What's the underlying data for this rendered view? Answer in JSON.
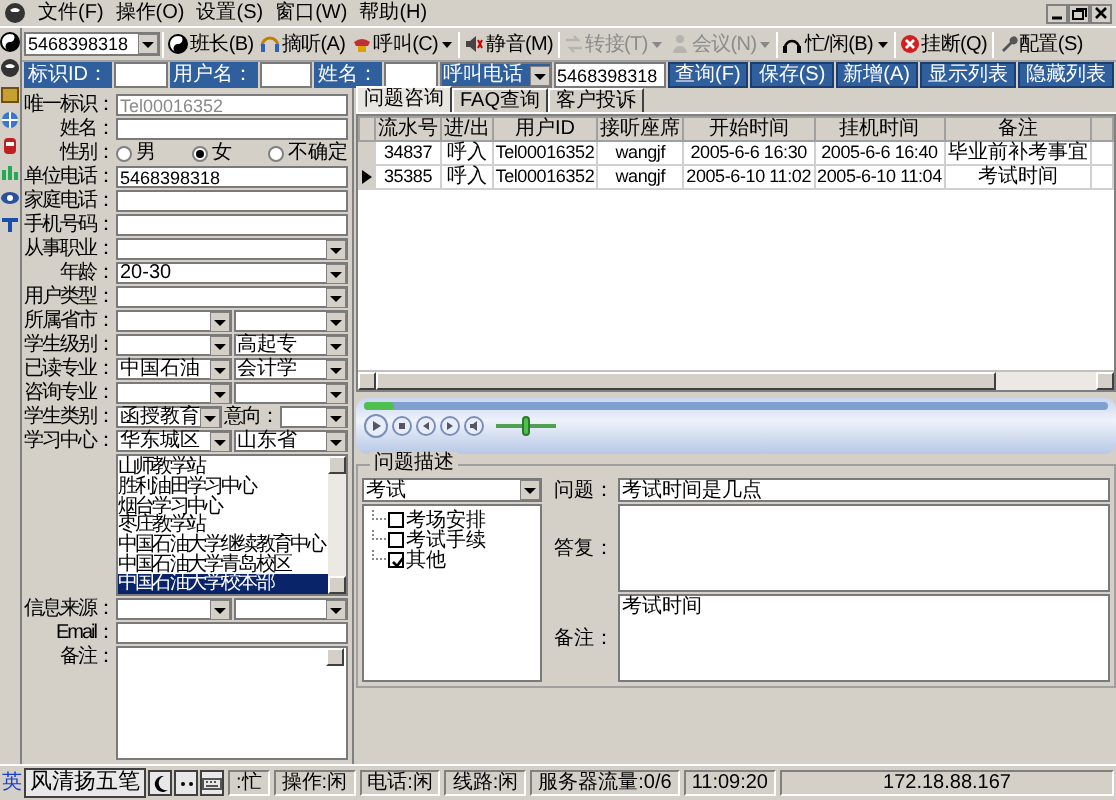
{
  "menu": [
    "文件(F)",
    "操作(O)",
    "设置(S)",
    "窗口(W)",
    "帮助(H)"
  ],
  "toolbar": {
    "phone": "5468398318",
    "buttons": [
      {
        "label": "班长(B)",
        "dropdown": false,
        "disabled": false
      },
      {
        "label": "摘听(A)",
        "dropdown": false,
        "disabled": false
      },
      {
        "label": "呼叫(C)",
        "dropdown": true,
        "disabled": false
      },
      {
        "label": "静音(M)",
        "dropdown": false,
        "disabled": false
      },
      {
        "label": "转接(T)",
        "dropdown": true,
        "disabled": true
      },
      {
        "label": "会议(N)",
        "dropdown": true,
        "disabled": true
      },
      {
        "label": "忙/闲(B)",
        "dropdown": true,
        "disabled": false
      },
      {
        "label": "挂断(Q)",
        "dropdown": false,
        "disabled": false
      },
      {
        "label": "配置(S)",
        "dropdown": false,
        "disabled": false
      }
    ]
  },
  "search": {
    "fields": [
      {
        "label": "标识ID："
      },
      {
        "label": "用户名："
      },
      {
        "label": "姓名："
      }
    ],
    "phone_type": "呼叫电话",
    "phone_value": "5468398318",
    "buttons": [
      "查询(F)",
      "保存(S)",
      "新增(A)",
      "显示列表",
      "隐藏列表"
    ]
  },
  "form": [
    {
      "kind": "text",
      "label": "唯一标识：",
      "value": "Tel00016352",
      "disabled": true
    },
    {
      "kind": "text",
      "label": "姓名："
    },
    {
      "kind": "radio",
      "label": "性别：",
      "options": [
        {
          "label": "男",
          "selected": false
        },
        {
          "label": "女",
          "selected": true
        },
        {
          "label": "不确定",
          "selected": false
        }
      ]
    },
    {
      "kind": "text",
      "label": "单位电话：",
      "value": "5468398318"
    },
    {
      "kind": "text",
      "label": "家庭电话："
    },
    {
      "kind": "text",
      "label": "手机号码："
    },
    {
      "kind": "select",
      "label": "从事职业：",
      "selects": [
        {
          "kind": "blank"
        }
      ]
    },
    {
      "kind": "select",
      "label": "年龄：",
      "selects": [
        {
          "kind": "filled",
          "value": "20-30"
        }
      ]
    },
    {
      "kind": "select",
      "label": "用户类型：",
      "selects": [
        {
          "kind": "blank"
        }
      ]
    },
    {
      "kind": "select",
      "label": "所属省市：",
      "selects": [
        {
          "kind": "blank"
        },
        {
          "kind": "blank"
        }
      ]
    },
    {
      "kind": "select",
      "label": "学生级别：",
      "selects": [
        {
          "kind": "blank"
        },
        {
          "kind": "filled",
          "value": "高起专"
        }
      ]
    },
    {
      "kind": "select",
      "label": "已读专业：",
      "selects": [
        {
          "kind": "filled",
          "value": "中国石油"
        },
        {
          "kind": "filled",
          "value": "会计学"
        }
      ]
    },
    {
      "kind": "select",
      "label": "咨询专业：",
      "selects": [
        {
          "kind": "blank"
        },
        {
          "kind": "blank"
        }
      ]
    },
    {
      "kind": "select",
      "label": "学生类别：",
      "selects": [
        {
          "kind": "filled",
          "value": "函授教育"
        },
        {
          "kind": "blank"
        }
      ],
      "inner_label": "意向："
    },
    {
      "kind": "select",
      "label": "学习中心：",
      "selects": [
        {
          "kind": "filled",
          "value": "华东城区"
        },
        {
          "kind": "filled",
          "value": "山东省"
        }
      ]
    },
    {
      "kind": "list",
      "items": [
        {
          "label": "山师教学站",
          "selected": false
        },
        {
          "label": "胜利油田学习中心",
          "selected": false
        },
        {
          "label": "烟台学习中心",
          "selected": false
        },
        {
          "label": "枣庄教学站",
          "selected": false
        },
        {
          "label": "中国石油大学继续教育中心",
          "selected": false
        },
        {
          "label": "中国石油大学青岛校区",
          "selected": false
        },
        {
          "label": "中国石油大学校本部",
          "selected": true
        }
      ]
    },
    {
      "kind": "select",
      "label": "信息来源：",
      "selects": [
        {
          "kind": "blank"
        },
        {
          "kind": "blank"
        }
      ]
    },
    {
      "kind": "text",
      "label": "Email："
    },
    {
      "kind": "area",
      "label": "备注："
    }
  ],
  "tabs": [
    {
      "label": "问题咨询",
      "selected": true
    },
    {
      "label": "FAQ查询",
      "selected": false
    },
    {
      "label": "客户投诉",
      "selected": false
    }
  ],
  "table": {
    "columns": [
      "流水号",
      "进/出",
      "用户ID",
      "接听座席",
      "开始时间",
      "挂机时间",
      "备注"
    ],
    "rows": [
      {
        "selected": false,
        "cells": [
          "34837",
          "呼入",
          "Tel00016352",
          "wangjf",
          "2005-6-6 16:30",
          "2005-6-6 16:40",
          "毕业前补考事宜"
        ]
      },
      {
        "selected": true,
        "cells": [
          "35385",
          "呼入",
          "Tel00016352",
          "wangjf",
          "2005-6-10 11:02",
          "2005-6-10 11:04",
          "考试时间"
        ]
      }
    ]
  },
  "player": {
    "seek": {
      "level": 0.04
    },
    "volume": {
      "level": 0.5
    }
  },
  "problem": {
    "title": "问题描述",
    "category": "考试",
    "topics": [
      {
        "label": "考场安排",
        "checked": false
      },
      {
        "label": "考试手续",
        "checked": false
      },
      {
        "label": "其他",
        "checked": true
      }
    ],
    "fields": [
      {
        "kind": "line",
        "label": "问题：",
        "value": "考试时间是几点"
      },
      {
        "kind": "area",
        "label": "答复："
      },
      {
        "kind": "area",
        "label": "备注：",
        "value": "考试时间"
      }
    ]
  },
  "status_bar": {
    "ime": {
      "mode": "英",
      "name": "风清扬五笔"
    },
    "panels": [
      ":忙",
      "操作:闲",
      "电话:闲",
      "线路:闲",
      "服务器流量:0/6",
      "11:09:20",
      "172.18.88.167"
    ]
  }
}
